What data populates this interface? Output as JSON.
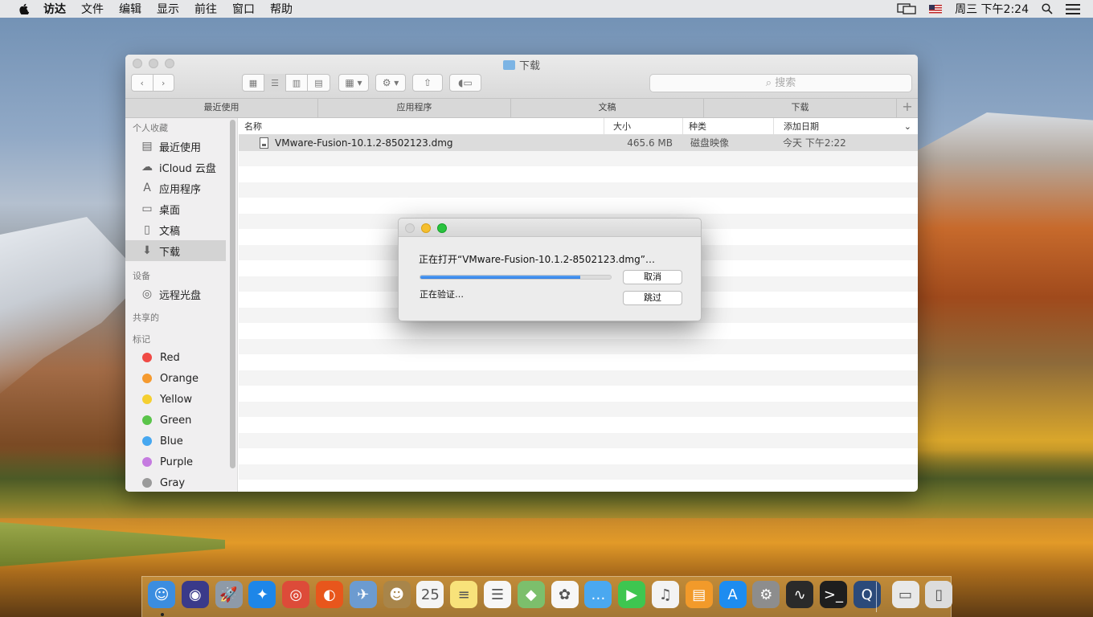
{
  "menubar": {
    "items": [
      "访达",
      "文件",
      "编辑",
      "显示",
      "前往",
      "窗口",
      "帮助"
    ],
    "clock": "周三 下午2:24"
  },
  "finder": {
    "title": "下载",
    "search_placeholder": "搜索",
    "tabs": [
      "最近使用",
      "应用程序",
      "文稿",
      "下载"
    ],
    "sidebar": {
      "favorites_header": "个人收藏",
      "favorites": [
        {
          "label": "最近使用",
          "icon": "recents-icon"
        },
        {
          "label": "iCloud 云盘",
          "icon": "cloud-icon"
        },
        {
          "label": "应用程序",
          "icon": "applications-icon"
        },
        {
          "label": "桌面",
          "icon": "desktop-icon"
        },
        {
          "label": "文稿",
          "icon": "document-icon"
        },
        {
          "label": "下载",
          "icon": "download-icon",
          "selected": true
        }
      ],
      "devices_header": "设备",
      "devices": [
        {
          "label": "远程光盘",
          "icon": "disc-icon"
        }
      ],
      "shared_header": "共享的",
      "tags_header": "标记",
      "tags": [
        {
          "label": "Red",
          "color": "#f04a45"
        },
        {
          "label": "Orange",
          "color": "#f59a2f"
        },
        {
          "label": "Yellow",
          "color": "#f5cf30"
        },
        {
          "label": "Green",
          "color": "#5ac44a"
        },
        {
          "label": "Blue",
          "color": "#46a7f0"
        },
        {
          "label": "Purple",
          "color": "#c57be0"
        },
        {
          "label": "Gray",
          "color": "#9a9a9a"
        }
      ]
    },
    "columns": {
      "name": "名称",
      "size": "大小",
      "kind": "种类",
      "date": "添加日期"
    },
    "files": [
      {
        "name": "VMware-Fusion-10.1.2-8502123.dmg",
        "size": "465.6 MB",
        "kind": "磁盘映像",
        "date": "今天 下午2:22"
      }
    ]
  },
  "dialog": {
    "message": "正在打开“VMware-Fusion-10.1.2-8502123.dmg”…",
    "status": "正在验证…",
    "progress": 0.84,
    "cancel_label": "取消",
    "skip_label": "跳过"
  },
  "dock": {
    "apps": [
      {
        "name": "finder-icon",
        "color": "#3b8de0",
        "glyph": "☺"
      },
      {
        "name": "siri-icon",
        "color": "#3a3a8a",
        "glyph": "◉"
      },
      {
        "name": "launchpad-icon",
        "color": "#8e9aa8",
        "glyph": "🚀"
      },
      {
        "name": "safari-icon",
        "color": "#1d86e8",
        "glyph": "✦"
      },
      {
        "name": "chrome-icon",
        "color": "#dd4b39",
        "glyph": "◎"
      },
      {
        "name": "firefox-icon",
        "color": "#e8561c",
        "glyph": "◐"
      },
      {
        "name": "preview-icon",
        "color": "#6c9bd0",
        "glyph": "✈"
      },
      {
        "name": "contacts-icon",
        "color": "#a8854a",
        "glyph": "☻"
      },
      {
        "name": "calendar-icon",
        "color": "#f4f4f4",
        "glyph": "25"
      },
      {
        "name": "notes-icon",
        "color": "#f8e27a",
        "glyph": "≡"
      },
      {
        "name": "reminders-icon",
        "color": "#f7f7f7",
        "glyph": "☰"
      },
      {
        "name": "maps-icon",
        "color": "#7cbf6c",
        "glyph": "◆"
      },
      {
        "name": "photos-icon",
        "color": "#f7f7f7",
        "glyph": "✿"
      },
      {
        "name": "messages-icon",
        "color": "#4aa8f0",
        "glyph": "…"
      },
      {
        "name": "facetime-icon",
        "color": "#3ec650",
        "glyph": "▶"
      },
      {
        "name": "itunes-icon",
        "color": "#f3f3f3",
        "glyph": "♫"
      },
      {
        "name": "ibooks-icon",
        "color": "#f29a2a",
        "glyph": "▤"
      },
      {
        "name": "appstore-icon",
        "color": "#1d8cf0",
        "glyph": "A"
      },
      {
        "name": "system-preferences-icon",
        "color": "#8d8d8d",
        "glyph": "⚙"
      },
      {
        "name": "activity-monitor-icon",
        "color": "#2a2a2a",
        "glyph": "∿"
      },
      {
        "name": "terminal-icon",
        "color": "#1e1e1e",
        "glyph": ">_"
      },
      {
        "name": "quicktime-icon",
        "color": "#2b4a7a",
        "glyph": "Q"
      },
      {
        "name": "downloads-stack-icon",
        "color": "#e8e8e8",
        "glyph": "▭"
      },
      {
        "name": "trash-icon",
        "color": "#dcdcdc",
        "glyph": "▯"
      }
    ]
  }
}
